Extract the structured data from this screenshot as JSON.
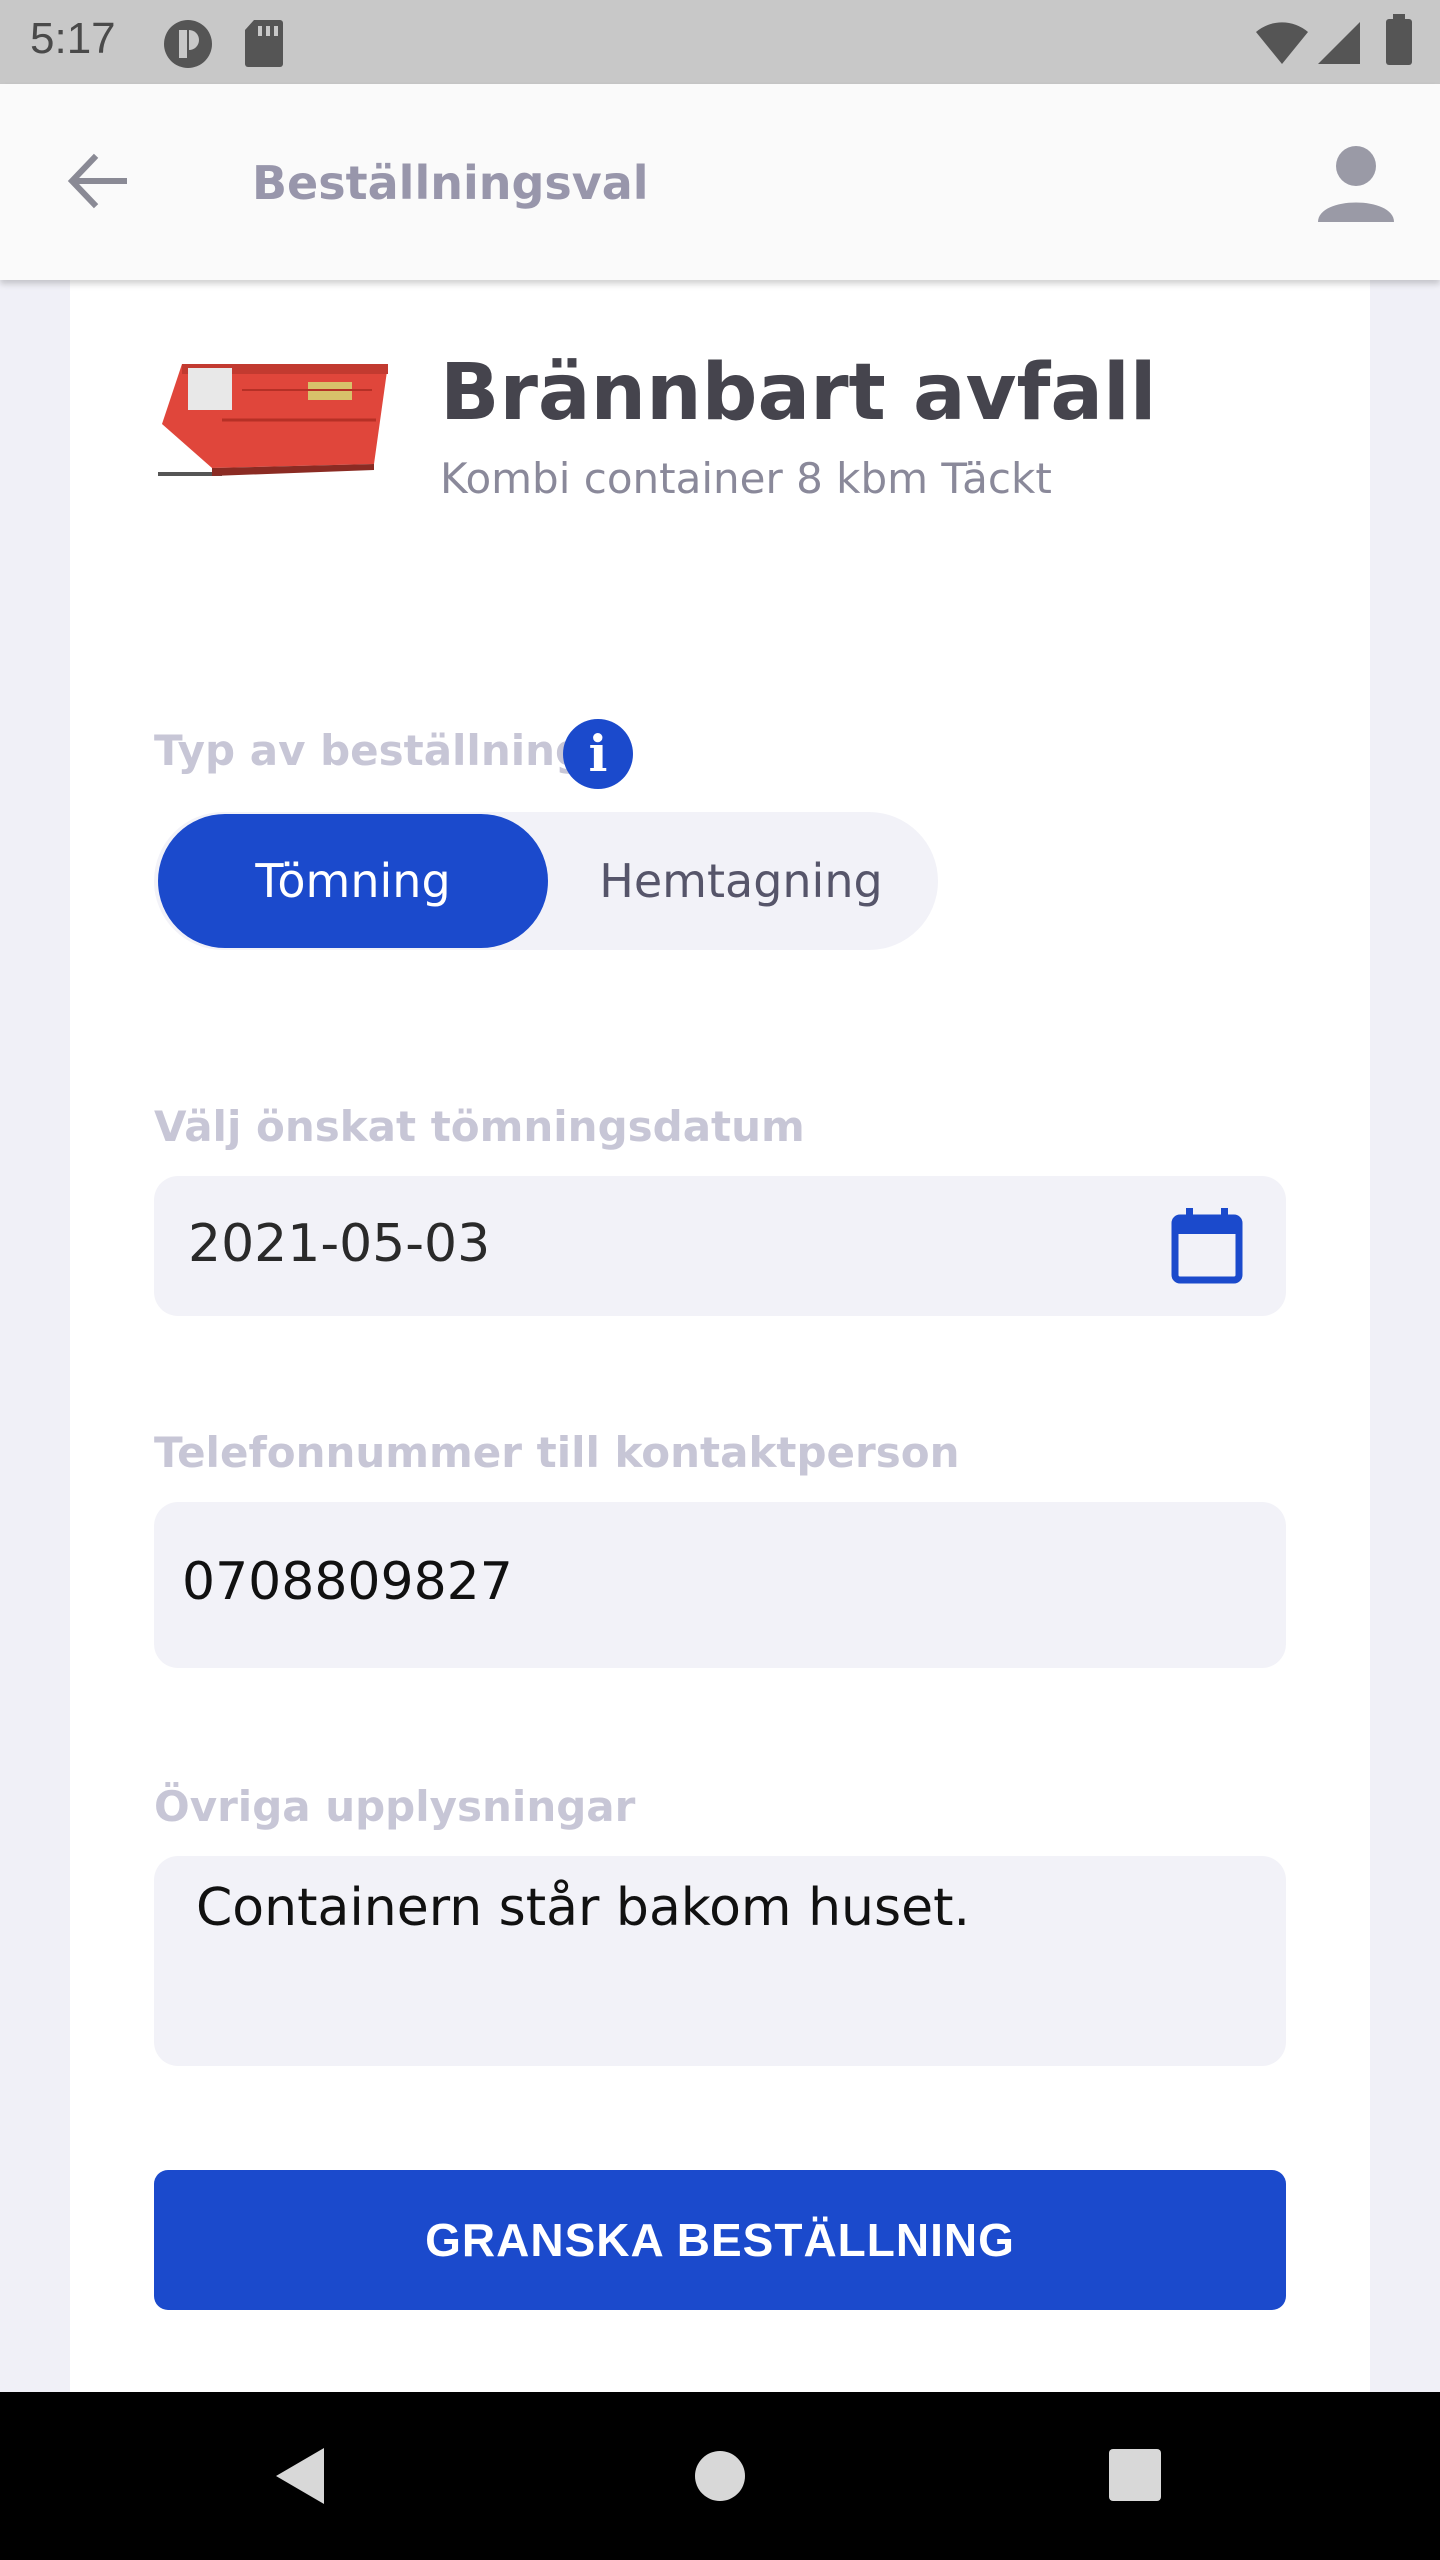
{
  "status_bar": {
    "time": "5:17"
  },
  "app_bar": {
    "title": "Beställningsval"
  },
  "product": {
    "title": "Brännbart avfall",
    "subtitle": "Kombi container 8 kbm Täckt"
  },
  "order_type": {
    "label": "Typ av beställning",
    "options": [
      "Tömning",
      "Hemtagning"
    ],
    "selected": "Tömning"
  },
  "date_field": {
    "label": "Välj önskat tömningsdatum",
    "value": "2021-05-03"
  },
  "phone_field": {
    "label": "Telefonnummer till kontaktperson",
    "value": "0708809827"
  },
  "notes_field": {
    "label": "Övriga upplysningar",
    "value": "Containern står bakom huset."
  },
  "submit_button": {
    "label": "GRANSKA BESTÄLLNING"
  },
  "colors": {
    "accent": "#1b4acc",
    "field_bg": "#f2f2f8",
    "label": "#c7c6d6"
  }
}
